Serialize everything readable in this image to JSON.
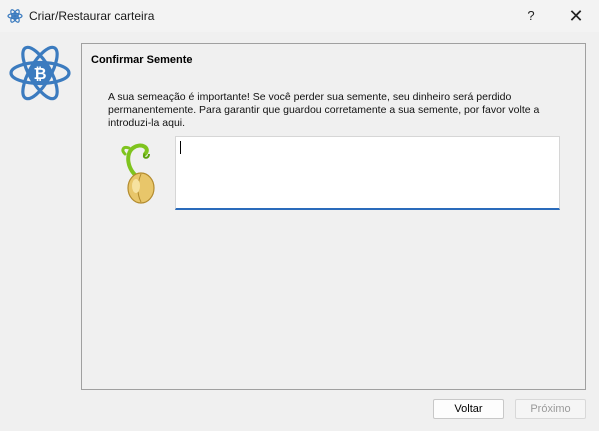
{
  "window": {
    "title": "Criar/Restaurar carteira",
    "help_label": "?",
    "close_label": "✕"
  },
  "icons": {
    "app": "electrum-atom-icon",
    "logo": "electrum-bitcoin-logo-icon",
    "seed": "sprouting-seed-icon"
  },
  "panel": {
    "title": "Confirmar Semente",
    "message": "A sua semeação é importante! Se você perder sua semente, seu dinheiro será perdido permanentemente. Para garantir que guardou corretamente a sua semente, por favor volte a introduzi-la aqui.",
    "seed_input_value": ""
  },
  "buttons": {
    "back": "Voltar",
    "next": "Próximo"
  },
  "colors": {
    "accent": "#2a6bbb",
    "logo_blue": "#3b7bbf"
  }
}
